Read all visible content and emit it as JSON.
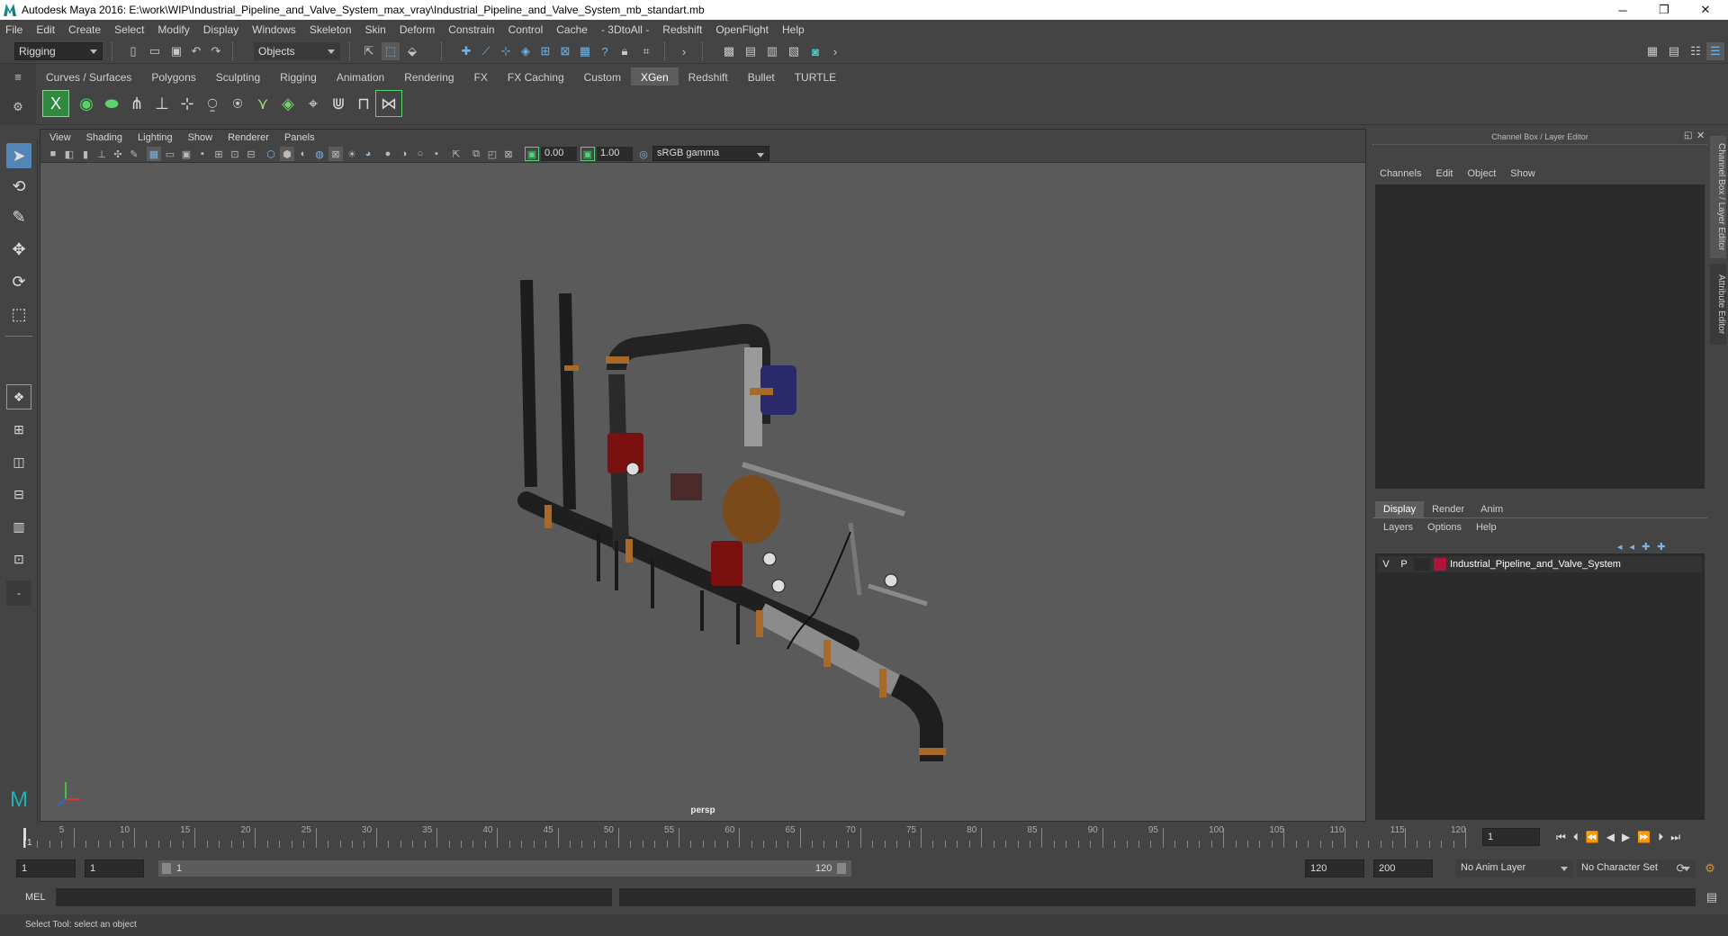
{
  "window": {
    "title": "Autodesk Maya 2016: E:\\work\\WIP\\Industrial_Pipeline_and_Valve_System_max_vray\\Industrial_Pipeline_and_Valve_System_mb_standart.mb",
    "minimize": "─",
    "restore": "❐",
    "close": "✕"
  },
  "menu": [
    "File",
    "Edit",
    "Create",
    "Select",
    "Modify",
    "Display",
    "Windows",
    "Skeleton",
    "Skin",
    "Deform",
    "Constrain",
    "Control",
    "Cache",
    "- 3DtoAll -",
    "Redshift",
    "OpenFlight",
    "Help"
  ],
  "statusline": {
    "mode": "Rigging",
    "objects": "Objects"
  },
  "shelf": {
    "tabs": [
      "Curves / Surfaces",
      "Polygons",
      "Sculpting",
      "Rigging",
      "Animation",
      "Rendering",
      "FX",
      "FX Caching",
      "Custom",
      "XGen",
      "Redshift",
      "Bullet",
      "TURTLE"
    ],
    "active": "XGen"
  },
  "viewport": {
    "menu": [
      "View",
      "Shading",
      "Lighting",
      "Show",
      "Renderer",
      "Panels"
    ],
    "exposure": "0.00",
    "gamma": "1.00",
    "colorspace": "sRGB gamma",
    "camera": "persp"
  },
  "channelbox": {
    "title": "Channel Box / Layer Editor",
    "menu": [
      "Channels",
      "Edit",
      "Object",
      "Show"
    ]
  },
  "layereditor": {
    "tabs": [
      "Display",
      "Render",
      "Anim"
    ],
    "active": "Display",
    "menu": [
      "Layers",
      "Options",
      "Help"
    ],
    "layer": {
      "v": "V",
      "p": "P",
      "name": "Industrial_Pipeline_and_Valve_System",
      "color": "#b0153a"
    }
  },
  "sidetabs": {
    "channel": "Channel Box / Layer Editor",
    "attribute": "Attribute Editor"
  },
  "timeline": {
    "ticks": [
      "5",
      "10",
      "15",
      "20",
      "25",
      "30",
      "35",
      "40",
      "45",
      "50",
      "55",
      "60",
      "65",
      "70",
      "75",
      "80",
      "85",
      "90",
      "95",
      "100",
      "105",
      "110",
      "115",
      "120"
    ],
    "current_marker": "1",
    "current_frame": "1"
  },
  "range": {
    "start": "1",
    "anim_start": "1",
    "slider_start": "1",
    "slider_end": "120",
    "end": "120",
    "anim_end": "200",
    "anim_layer": "No Anim Layer",
    "char_set": "No Character Set"
  },
  "cmd": {
    "label": "MEL"
  },
  "help": {
    "text": "Select Tool: select an object"
  },
  "colors": {
    "accent": "#5385b6",
    "active_tab": "#5d5d5d",
    "viewport_bg": "#5a5a5a"
  }
}
